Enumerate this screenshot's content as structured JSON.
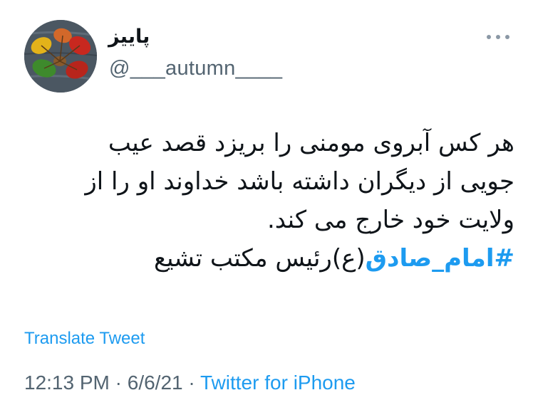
{
  "profile": {
    "display_name": "پاییز",
    "handle": "@___autumn____"
  },
  "tweet": {
    "lines": [
      "هر کس آبروی مومنی را بریزد قصد عیب",
      "جویی از دیگران داشته باشد خداوند او را از",
      "ولایت خود خارج می کند."
    ],
    "hashtag": "#امام_صادق",
    "last_line_rest": "(ع)رئیس مکتب تشیع"
  },
  "actions": {
    "translate": "Translate Tweet"
  },
  "meta": {
    "time": "12:13 PM",
    "separator1": " · ",
    "date": "6/6/21",
    "separator2": " · ",
    "source": "Twitter for iPhone"
  },
  "icons": {
    "more": "more-horizontal-icon",
    "avatar": "autumn-leaves-avatar"
  },
  "colors": {
    "link": "#1d9bf0",
    "secondary_text": "#536471",
    "primary_text": "#0f1419"
  }
}
